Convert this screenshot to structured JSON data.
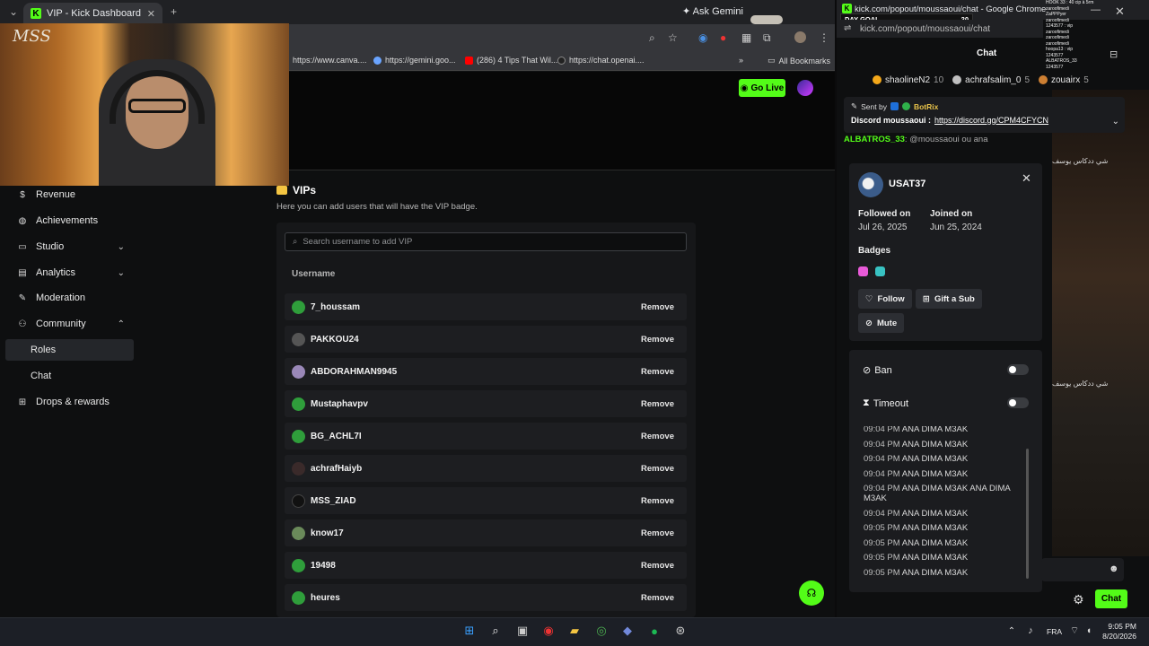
{
  "browser": {
    "tab_title": "VIP - Kick Dashboard",
    "ask_gemini": "Ask Gemini",
    "bookmarks": [
      {
        "label": "https://www.canva...."
      },
      {
        "label": "https://gemini.goo..."
      },
      {
        "label": "(286) 4 Tips That Wil..."
      },
      {
        "label": "https://chat.openai...."
      }
    ],
    "all_bookmarks": "All Bookmarks",
    "icons": [
      "search-icon",
      "star-icon",
      "extension-icon",
      "profile-icon",
      "menu-icon"
    ]
  },
  "webcam": {
    "logo_text": "MSS"
  },
  "dashboard": {
    "go_live": "Go Live",
    "sidebar": {
      "items": [
        {
          "label": "Revenue",
          "icon": "dollar-icon"
        },
        {
          "label": "Achievements",
          "icon": "globe-icon"
        },
        {
          "label": "Studio",
          "icon": "monitor-icon"
        },
        {
          "label": "Analytics",
          "icon": "chart-icon"
        },
        {
          "label": "Moderation",
          "icon": "wrench-icon"
        },
        {
          "label": "Community",
          "icon": "people-icon"
        },
        {
          "label": "Roles",
          "icon": ""
        },
        {
          "label": "Chat",
          "icon": ""
        },
        {
          "label": "Drops & rewards",
          "icon": "gift-icon"
        }
      ]
    },
    "vips": {
      "title": "VIPs",
      "description": "Here you can add users that will have the VIP badge.",
      "search_placeholder": "Search username to add VIP",
      "column": "Username",
      "remove_label": "Remove",
      "users": [
        "7_houssam",
        "PAKKOU24",
        "ABDORAHMAN9945",
        "Mustaphavpv",
        "BG_ACHL7I",
        "achrafHaiyb",
        "MSS_ZIAD",
        "know17",
        "19498",
        "heures"
      ]
    }
  },
  "popout": {
    "window_title": "kick.com/popout/moussaoui/chat - Google Chrome",
    "url": "kick.com/popout/moussaoui/chat",
    "day_goal": "DAY GOAL",
    "day_goal_count": "20",
    "chat_title": "Chat",
    "leaders": [
      {
        "name": "shaolineN2",
        "count": "10",
        "color": "#f4a81a"
      },
      {
        "name": "achrafsalim_0",
        "count": "5",
        "color": "#c0c0c0"
      },
      {
        "name": "zouairx",
        "count": "5",
        "color": "#cd7f32"
      }
    ],
    "pinned": {
      "sent_by": "Sent by",
      "bot": "BotRix",
      "message_prefix": "Discord moussaoui :",
      "link": "https://discord.gg/CPM4CFYCN"
    },
    "reply_preview": {
      "user": "ALBATROS_33",
      "text": "@moussaoui ou ana"
    },
    "user_card": {
      "username": "USAT37",
      "followed_label": "Followed on",
      "followed_date": "Jul 26, 2025",
      "joined_label": "Joined on",
      "joined_date": "Jun 25, 2024",
      "badges_label": "Badges",
      "follow": "Follow",
      "gift": "Gift a Sub",
      "mute": "Mute"
    },
    "mod": {
      "ban": "Ban",
      "timeout": "Timeout",
      "messages": [
        {
          "time": "09:04 PM",
          "text": "ANA DIMA M3AK"
        },
        {
          "time": "09:04 PM",
          "text": "ANA DIMA M3AK"
        },
        {
          "time": "09:04 PM",
          "text": "ANA DIMA M3AK"
        },
        {
          "time": "09:04 PM",
          "text": "ANA DIMA M3AK"
        },
        {
          "time": "09:04 PM",
          "text": "ANA DIMA M3AK ANA DIMA M3AK"
        },
        {
          "time": "09:04 PM",
          "text": "ANA DIMA M3AK"
        },
        {
          "time": "09:05 PM",
          "text": "ANA DIMA M3AK"
        },
        {
          "time": "09:05 PM",
          "text": "ANA DIMA M3AK"
        },
        {
          "time": "09:05 PM",
          "text": "ANA DIMA M3AK"
        },
        {
          "time": "09:05 PM",
          "text": "ANA DIMA M3AK"
        }
      ]
    },
    "side_text_1": "شي ددكاس يوسف",
    "side_text_2": "شي ددكاس يوسف",
    "chat_button": "Chat"
  },
  "overlay_list": [
    "HOOK 33 : 40 cip à 5rm",
    "zaroofimedi",
    "ZaPPPyer",
    "zaroofimedi",
    "1243577 : vip",
    "zaroofimedi",
    "zaroofimedi",
    "zaroofimedi",
    "hoopa13 : vip",
    "1243577",
    "ALBATROS_33",
    "1243577"
  ],
  "taskbar": {
    "lang": "FRA",
    "time": "9:05 PM",
    "date": "8/20/2026"
  }
}
